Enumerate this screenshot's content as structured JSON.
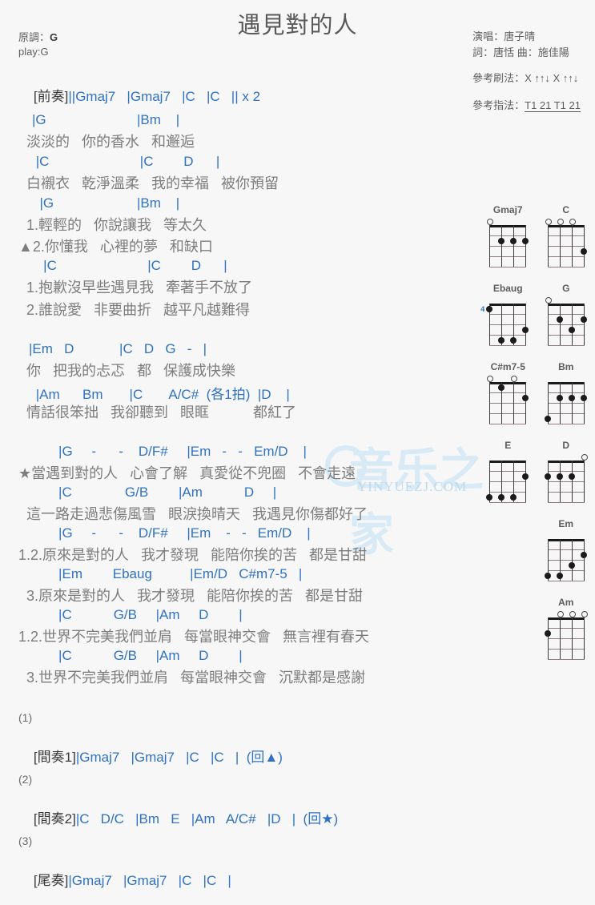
{
  "header": {
    "title": "遇見對的人",
    "original_key_label": "原調：",
    "original_key": "G",
    "play_key": "play:G",
    "singer": "演唱：唐子晴",
    "writers": "詞：唐恬  曲：施佳陽",
    "strum_label": "參考刷法：",
    "strum_pattern": "X ↑↑↓ X ↑↑↓",
    "pick_label": "參考指法：",
    "pick_pattern": "T1 21 T1 21"
  },
  "intro": {
    "label": "[前奏]",
    "chords": "||Gmaj7   |Gmaj7   |C   |C   || x 2"
  },
  "verse": [
    {
      "chords": "|G                        |Bm    |",
      "lyric": "淡淡的   你的香水   和邂逅"
    },
    {
      "chords": " |C                        |C        D      |",
      "lyric": "白襯衣   乾淨溫柔   我的幸福   被你預留"
    },
    {
      "chords": "  |G                      |Bm    |",
      "lyric": "1.輕輕的   你說讓我   等太久"
    },
    {
      "chords": "",
      "lyric": "▲2.你懂我   心裡的夢   和缺口"
    },
    {
      "chords": "   |C                        |C        D      |",
      "lyric": "1.抱歉沒早些遇見我   牽著手不放了"
    },
    {
      "chords": "",
      "lyric": "2.誰說愛   非要曲折   越平凡越難得"
    }
  ],
  "pre_chorus": [
    {
      "chords": "|Em   D            |C   D   G   -   |",
      "lyric": "你   把我的忐忑   都   保護成快樂"
    },
    {
      "chords": " |Am      Bm       |C       A/C#  (各1拍)  |D    |",
      "lyric": "情話很笨拙   我卻聽到   眼眶           都紅了"
    }
  ],
  "chorus": [
    {
      "chords": "       |G     -      -    D/F#     |Em   -   -   Em/D    |",
      "lyric": "★當遇到對的人   心會了解   真愛從不兜圈   不會走遠"
    },
    {
      "chords": "       |C              G/B        |Am           D     |",
      "lyric": "這一路走過悲傷風雪   眼淚換晴天   我遇見你傷都好了"
    },
    {
      "chords": "       |G     -      -    D/F#     |Em    -   -   Em/D    |",
      "lyric": "1.2.原來是對的人   我才發現   能陪你挨的苦   都是甘甜"
    },
    {
      "chords": "       |Em        Ebaug          |Em/D   C#m7-5   |",
      "lyric": "3.原來是對的人   我才發現   能陪你挨的苦   都是甘甜"
    },
    {
      "chords": "       |C           G/B     |Am     D        |",
      "lyric": "1.2.世界不完美我們並肩   每當眼神交會   無言裡有春天"
    },
    {
      "chords": "       |C           G/B     |Am     D        |",
      "lyric": "3.世界不完美我們並肩   每當眼神交會   沉默都是感謝"
    }
  ],
  "sections": [
    {
      "number": "(1)",
      "label": "[間奏1]",
      "chords": "|Gmaj7   |Gmaj7   |C   |C   |  (回▲)"
    },
    {
      "number": "(2)",
      "label": "[間奏2]",
      "chords": "|C   D/C   |Bm   E   |Am   A/C#   |D   |  (回★)"
    },
    {
      "number": "(3)",
      "label": "[尾奏]",
      "chords": "|Gmaj7   |Gmaj7   |C   |C   |"
    }
  ],
  "chord_diagrams": [
    {
      "name": "Gmaj7",
      "opens": [
        1,
        0,
        0,
        0
      ],
      "dots": [
        [
          2,
          2
        ],
        [
          3,
          2
        ],
        [
          4,
          2
        ]
      ],
      "start_fret": ""
    },
    {
      "name": "C",
      "opens": [
        1,
        1,
        1,
        0
      ],
      "dots": [
        [
          4,
          3
        ]
      ],
      "start_fret": ""
    },
    {
      "name": "Ebaug",
      "opens": [
        0,
        0,
        0,
        0
      ],
      "dots": [
        [
          1,
          1
        ],
        [
          4,
          3
        ],
        [
          2,
          4
        ],
        [
          3,
          4
        ]
      ],
      "start_fret": "4"
    },
    {
      "name": "G",
      "opens": [
        1,
        0,
        0,
        0
      ],
      "dots": [
        [
          2,
          2
        ],
        [
          4,
          2
        ],
        [
          3,
          3
        ]
      ],
      "start_fret": ""
    },
    {
      "name": "C#m7-5",
      "opens": [
        1,
        0,
        1,
        0
      ],
      "dots": [
        [
          2,
          1
        ],
        [
          4,
          2
        ]
      ],
      "start_fret": ""
    },
    {
      "name": "Bm",
      "opens": [
        0,
        0,
        0,
        0
      ],
      "dots": [
        [
          2,
          2
        ],
        [
          3,
          2
        ],
        [
          4,
          2
        ],
        [
          1,
          4
        ]
      ],
      "start_fret": ""
    },
    {
      "name": "E",
      "opens": [
        0,
        0,
        0,
        0
      ],
      "dots": [
        [
          4,
          2
        ],
        [
          1,
          4
        ],
        [
          2,
          4
        ],
        [
          3,
          4
        ]
      ],
      "start_fret": ""
    },
    {
      "name": "D",
      "opens": [
        0,
        0,
        0,
        1
      ],
      "dots": [
        [
          1,
          2
        ],
        [
          2,
          2
        ],
        [
          3,
          2
        ]
      ],
      "start_fret": ""
    },
    {
      "name": "Em",
      "opens": [
        0,
        0,
        0,
        0
      ],
      "dots": [
        [
          4,
          2
        ],
        [
          3,
          3
        ],
        [
          1,
          4
        ],
        [
          2,
          4
        ]
      ],
      "start_fret": ""
    },
    {
      "name": "Am",
      "opens": [
        0,
        1,
        1,
        1
      ],
      "dots": [
        [
          1,
          2
        ]
      ],
      "start_fret": ""
    }
  ],
  "watermark": {
    "text": "YINYUEZJ.COM",
    "big": "音乐之家"
  },
  "colors": {
    "chord": "#2f72c4",
    "lyric": "#7d7d7d",
    "bar": "#9a6a4a",
    "bg": "#f7f7f7"
  }
}
